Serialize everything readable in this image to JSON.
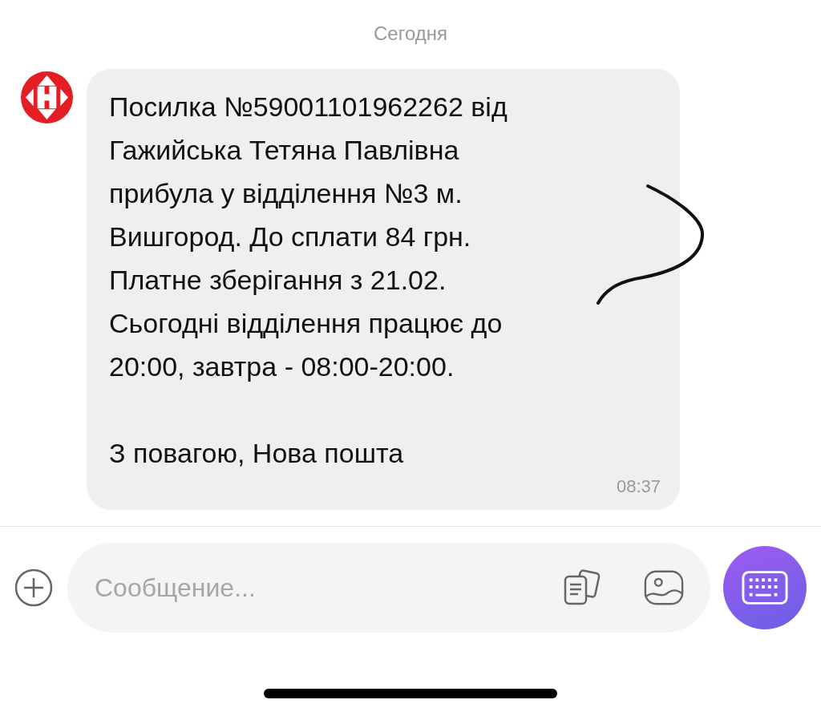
{
  "date_label": "Сегодня",
  "message": {
    "paragraphs": [
      [
        "Посилка №59001101962262 від",
        "Гажийська Тетяна Павлівна",
        "прибула у відділення №3 м.",
        "Вишгород. До сплати 84 грн.",
        "Платне зберігання з 21.02.",
        "Сьогодні відділення працює до",
        "20:00, завтра - 08:00-20:00."
      ],
      [
        "З повагою, Нова пошта"
      ]
    ],
    "time": "08:37"
  },
  "composer": {
    "placeholder": "Сообщение..."
  }
}
